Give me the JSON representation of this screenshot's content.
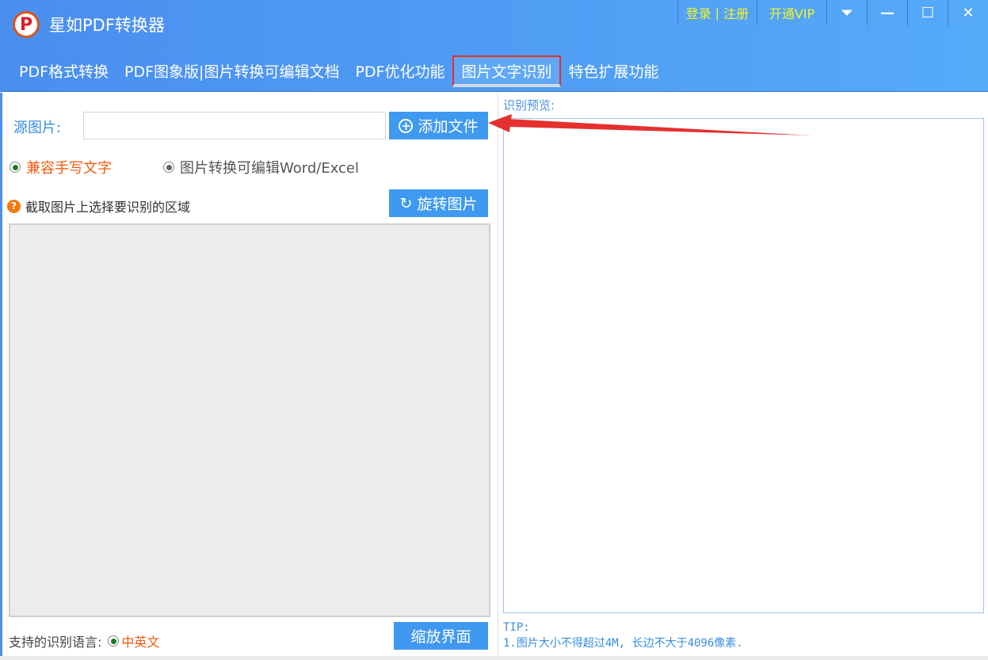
{
  "app": {
    "title": "星如PDF转换器",
    "logo_letter": "P"
  },
  "topbar": {
    "login": "登录",
    "separator": "|",
    "register": "注册",
    "vip": "开通VIP"
  },
  "tabs": [
    {
      "label": "PDF格式转换"
    },
    {
      "label": "PDF图象版|图片转换可编辑文档"
    },
    {
      "label": "PDF优化功能"
    },
    {
      "label": "图片文字识别"
    },
    {
      "label": "特色扩展功能"
    }
  ],
  "left": {
    "source_label": "源图片:",
    "source_value": "",
    "add_file": "添加文件",
    "radio1": "兼容手写文字",
    "radio2": "图片转换可编辑Word/Excel",
    "help_text": "截取图片上选择要识别的区域",
    "rotate": "旋转图片",
    "lang_label": "支持的识别语言:",
    "lang_value": "中英文",
    "zoom_btn": "缩放界面"
  },
  "right": {
    "preview_label": "识别预览:",
    "tip_title": "TIP:",
    "tip_1": "1.图片大小不得超过4M, 长边不大于4096像素."
  },
  "colors": {
    "header": "#4a8ef0",
    "button": "#3f99f0",
    "accent_orange": "#f05a10",
    "vip_yellow": "#f5f52a",
    "annotation_red": "#e53030"
  }
}
